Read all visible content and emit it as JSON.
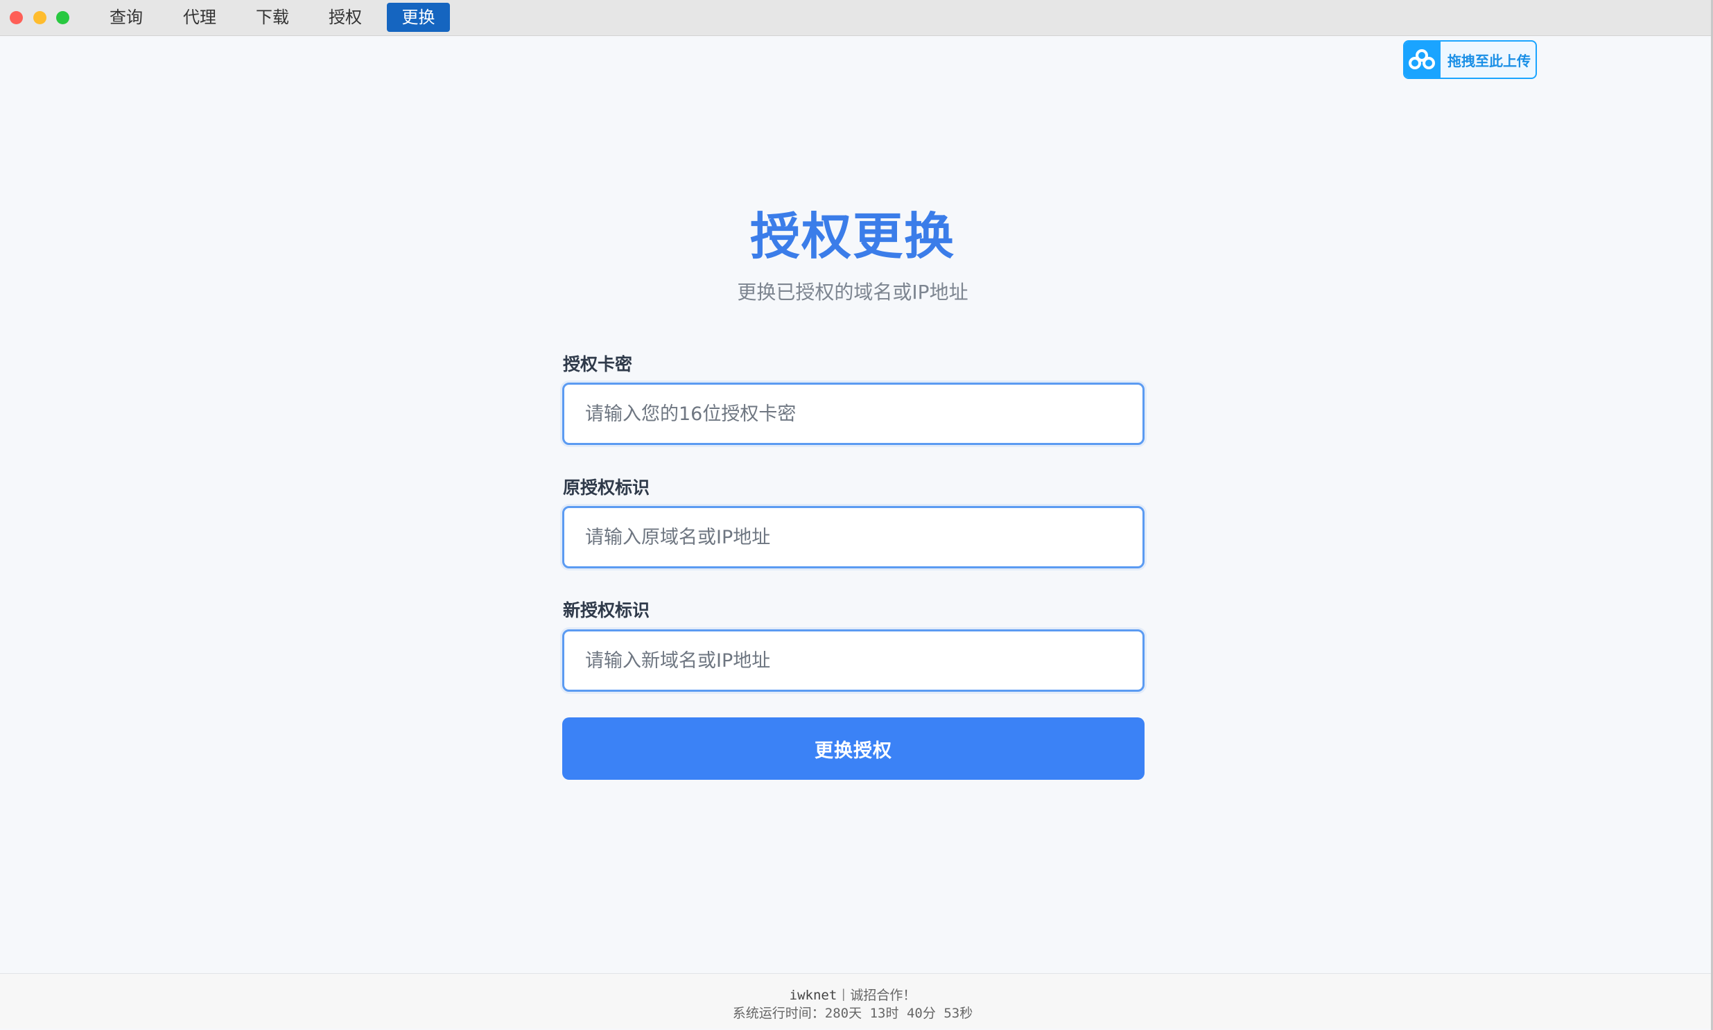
{
  "nav": {
    "tabs": [
      {
        "label": "查询",
        "active": false
      },
      {
        "label": "代理",
        "active": false
      },
      {
        "label": "下载",
        "active": false
      },
      {
        "label": "授权",
        "active": false
      },
      {
        "label": "更换",
        "active": true
      }
    ]
  },
  "upload": {
    "label": "拖拽至此上传",
    "icon": "cloud-upload-icon",
    "color": "#1aa4ff"
  },
  "page": {
    "title": "授权更换",
    "subtitle": "更换已授权的域名或IP地址"
  },
  "form": {
    "card": {
      "label": "授权卡密",
      "placeholder": "请输入您的16位授权卡密",
      "value": ""
    },
    "old_id": {
      "label": "原授权标识",
      "placeholder": "请输入原域名或IP地址",
      "value": ""
    },
    "new_id": {
      "label": "新授权标识",
      "placeholder": "请输入新域名或IP地址",
      "value": ""
    },
    "submit_label": "更换授权"
  },
  "footer": {
    "brand": "iwknet",
    "separator": "丨",
    "slogan": "诚招合作！",
    "uptime_prefix": "系统运行时间：",
    "uptime_days": "280",
    "days_unit": "天",
    "uptime_hours": "13",
    "hours_unit": "时",
    "uptime_minutes": "40",
    "minutes_unit": "分",
    "uptime_seconds": "53",
    "seconds_unit": "秒"
  },
  "colors": {
    "accent": "#3b82f6",
    "title": "#3b7de9",
    "active_tab": "#1565c0",
    "traffic_close": "#fe5f57",
    "traffic_min": "#febc2e",
    "traffic_max": "#28c840"
  }
}
